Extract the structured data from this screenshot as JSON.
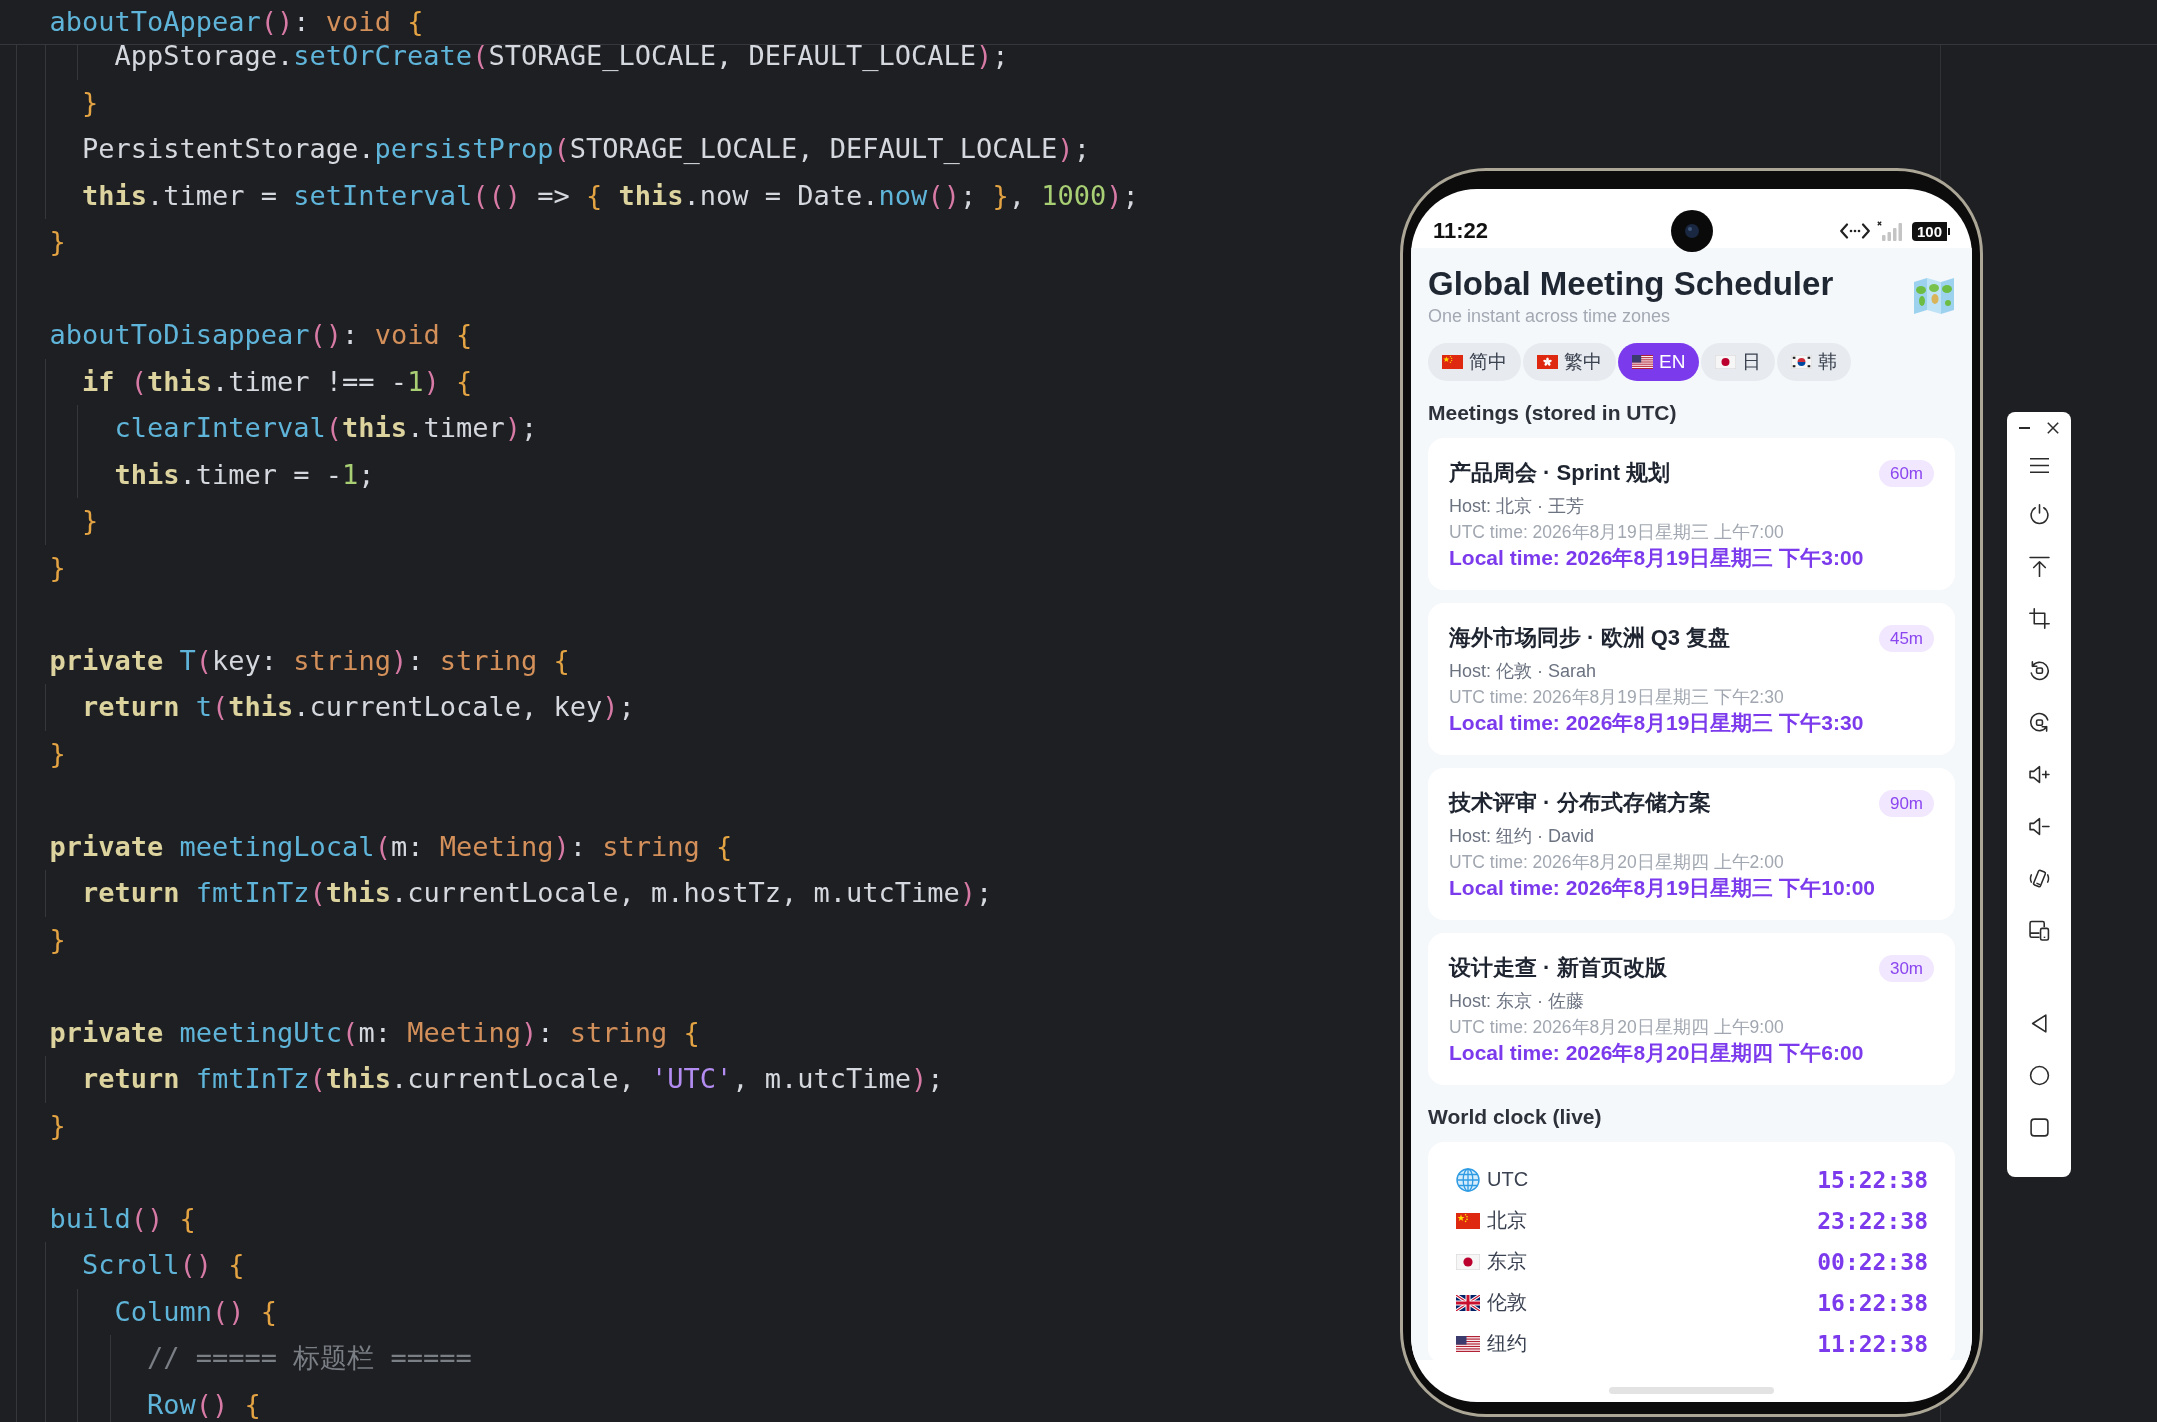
{
  "editor": {
    "sticky_line": {
      "tokens": [
        {
          "text": "  aboutToAppear",
          "kind": "function"
        },
        {
          "text": "()",
          "kind": "paren"
        },
        {
          "text": ": ",
          "kind": "plain"
        },
        {
          "text": "void",
          "kind": "type"
        },
        {
          "text": " {",
          "kind": "brace"
        }
      ]
    },
    "blocks": [
      {
        "lines": [
          {
            "tokens": [
              {
                "text": "      AppStorage.",
                "kind": "plain"
              },
              {
                "text": "setOrCreate",
                "kind": "function"
              },
              {
                "text": "(",
                "kind": "paren"
              },
              {
                "text": "STORAGE_LOCALE, DEFAULT_LOCALE",
                "kind": "plain"
              },
              {
                "text": ")",
                "kind": "paren"
              },
              {
                "text": ";",
                "kind": "plain"
              }
            ]
          },
          {
            "tokens": [
              {
                "text": "    }",
                "kind": "brace"
              }
            ]
          },
          {
            "tokens": [
              {
                "text": "    PersistentStorage.",
                "kind": "plain"
              },
              {
                "text": "persistProp",
                "kind": "function"
              },
              {
                "text": "(",
                "kind": "paren"
              },
              {
                "text": "STORAGE_LOCALE, DEFAULT_LOCALE",
                "kind": "plain"
              },
              {
                "text": ")",
                "kind": "paren"
              },
              {
                "text": ";",
                "kind": "plain"
              }
            ]
          },
          {
            "tokens": [
              {
                "text": "    this",
                "kind": "keyword"
              },
              {
                "text": ".timer = ",
                "kind": "plain"
              },
              {
                "text": "setInterval",
                "kind": "function"
              },
              {
                "text": "(()",
                "kind": "paren"
              },
              {
                "text": " => ",
                "kind": "plain"
              },
              {
                "text": "{",
                "kind": "brace"
              },
              {
                "text": " this",
                "kind": "keyword"
              },
              {
                "text": ".now = Date.",
                "kind": "plain"
              },
              {
                "text": "now",
                "kind": "function"
              },
              {
                "text": "()",
                "kind": "paren"
              },
              {
                "text": "; ",
                "kind": "plain"
              },
              {
                "text": "}",
                "kind": "brace"
              },
              {
                "text": ", ",
                "kind": "plain"
              },
              {
                "text": "1000",
                "kind": "number"
              },
              {
                "text": ")",
                "kind": "paren"
              },
              {
                "text": ";",
                "kind": "plain"
              }
            ]
          },
          {
            "tokens": [
              {
                "text": "  }",
                "kind": "brace"
              }
            ]
          }
        ]
      },
      {
        "lines": [
          {
            "tokens": [
              {
                "text": "  aboutToDisappear",
                "kind": "function"
              },
              {
                "text": "()",
                "kind": "paren"
              },
              {
                "text": ": ",
                "kind": "plain"
              },
              {
                "text": "void",
                "kind": "type"
              },
              {
                "text": " {",
                "kind": "brace"
              }
            ]
          },
          {
            "tokens": [
              {
                "text": "    if",
                "kind": "keyword"
              },
              {
                "text": " (",
                "kind": "paren"
              },
              {
                "text": "this",
                "kind": "keyword"
              },
              {
                "text": ".timer !== -",
                "kind": "plain"
              },
              {
                "text": "1",
                "kind": "number"
              },
              {
                "text": ")",
                "kind": "paren"
              },
              {
                "text": " {",
                "kind": "brace"
              }
            ]
          },
          {
            "tokens": [
              {
                "text": "      clearInterval",
                "kind": "function"
              },
              {
                "text": "(",
                "kind": "paren"
              },
              {
                "text": "this",
                "kind": "keyword"
              },
              {
                "text": ".timer",
                "kind": "plain"
              },
              {
                "text": ")",
                "kind": "paren"
              },
              {
                "text": ";",
                "kind": "plain"
              }
            ]
          },
          {
            "tokens": [
              {
                "text": "      this",
                "kind": "keyword"
              },
              {
                "text": ".timer = -",
                "kind": "plain"
              },
              {
                "text": "1",
                "kind": "number"
              },
              {
                "text": ";",
                "kind": "plain"
              }
            ]
          },
          {
            "tokens": [
              {
                "text": "    }",
                "kind": "brace"
              }
            ]
          },
          {
            "tokens": [
              {
                "text": "  }",
                "kind": "brace"
              }
            ]
          }
        ]
      },
      {
        "lines": [
          {
            "tokens": [
              {
                "text": "  private",
                "kind": "keyword"
              },
              {
                "text": " T",
                "kind": "function"
              },
              {
                "text": "(",
                "kind": "paren"
              },
              {
                "text": "key: ",
                "kind": "plain"
              },
              {
                "text": "string",
                "kind": "type"
              },
              {
                "text": ")",
                "kind": "paren"
              },
              {
                "text": ": ",
                "kind": "plain"
              },
              {
                "text": "string",
                "kind": "type"
              },
              {
                "text": " {",
                "kind": "brace"
              }
            ]
          },
          {
            "tokens": [
              {
                "text": "    return",
                "kind": "keyword"
              },
              {
                "text": " t",
                "kind": "function"
              },
              {
                "text": "(",
                "kind": "paren"
              },
              {
                "text": "this",
                "kind": "keyword"
              },
              {
                "text": ".currentLocale, key",
                "kind": "plain"
              },
              {
                "text": ")",
                "kind": "paren"
              },
              {
                "text": ";",
                "kind": "plain"
              }
            ]
          },
          {
            "tokens": [
              {
                "text": "  }",
                "kind": "brace"
              }
            ]
          }
        ]
      },
      {
        "lines": [
          {
            "tokens": [
              {
                "text": "  private",
                "kind": "keyword"
              },
              {
                "text": " meetingLocal",
                "kind": "function"
              },
              {
                "text": "(",
                "kind": "paren"
              },
              {
                "text": "m: ",
                "kind": "plain"
              },
              {
                "text": "Meeting",
                "kind": "type"
              },
              {
                "text": ")",
                "kind": "paren"
              },
              {
                "text": ": ",
                "kind": "plain"
              },
              {
                "text": "string",
                "kind": "type"
              },
              {
                "text": " {",
                "kind": "brace"
              }
            ]
          },
          {
            "tokens": [
              {
                "text": "    return",
                "kind": "keyword"
              },
              {
                "text": " fmtInTz",
                "kind": "function"
              },
              {
                "text": "(",
                "kind": "paren"
              },
              {
                "text": "this",
                "kind": "keyword"
              },
              {
                "text": ".currentLocale, m.hostTz, m.utcTime",
                "kind": "plain"
              },
              {
                "text": ")",
                "kind": "paren"
              },
              {
                "text": ";",
                "kind": "plain"
              }
            ]
          },
          {
            "tokens": [
              {
                "text": "  }",
                "kind": "brace"
              }
            ]
          }
        ]
      },
      {
        "lines": [
          {
            "tokens": [
              {
                "text": "  private",
                "kind": "keyword"
              },
              {
                "text": " meetingUtc",
                "kind": "function"
              },
              {
                "text": "(",
                "kind": "paren"
              },
              {
                "text": "m: ",
                "kind": "plain"
              },
              {
                "text": "Meeting",
                "kind": "type"
              },
              {
                "text": ")",
                "kind": "paren"
              },
              {
                "text": ": ",
                "kind": "plain"
              },
              {
                "text": "string",
                "kind": "type"
              },
              {
                "text": " {",
                "kind": "brace"
              }
            ]
          },
          {
            "tokens": [
              {
                "text": "    return",
                "kind": "keyword"
              },
              {
                "text": " fmtInTz",
                "kind": "function"
              },
              {
                "text": "(",
                "kind": "paren"
              },
              {
                "text": "this",
                "kind": "keyword"
              },
              {
                "text": ".currentLocale, ",
                "kind": "plain"
              },
              {
                "text": "'UTC'",
                "kind": "string"
              },
              {
                "text": ", m.utcTime",
                "kind": "plain"
              },
              {
                "text": ")",
                "kind": "paren"
              },
              {
                "text": ";",
                "kind": "plain"
              }
            ]
          },
          {
            "tokens": [
              {
                "text": "  }",
                "kind": "brace"
              }
            ]
          }
        ]
      },
      {
        "lines": [
          {
            "tokens": [
              {
                "text": "  build",
                "kind": "function"
              },
              {
                "text": "()",
                "kind": "paren"
              },
              {
                "text": " {",
                "kind": "brace"
              }
            ]
          },
          {
            "tokens": [
              {
                "text": "    Scroll",
                "kind": "function"
              },
              {
                "text": "()",
                "kind": "paren"
              },
              {
                "text": " {",
                "kind": "brace"
              }
            ]
          },
          {
            "tokens": [
              {
                "text": "      Column",
                "kind": "function"
              },
              {
                "text": "()",
                "kind": "paren"
              },
              {
                "text": " {",
                "kind": "brace"
              }
            ]
          },
          {
            "tokens": [
              {
                "text": "        // ===== 标题栏 =====",
                "kind": "comment"
              }
            ]
          },
          {
            "tokens": [
              {
                "text": "        Row",
                "kind": "function"
              },
              {
                "text": "()",
                "kind": "paren"
              },
              {
                "text": " {",
                "kind": "brace"
              }
            ]
          }
        ]
      }
    ]
  },
  "status_bar": {
    "time": "11:22",
    "battery": "100"
  },
  "app": {
    "title": "Global Meeting Scheduler",
    "subtitle": "One instant across time zones",
    "languages": [
      {
        "label": "简中",
        "kind": "cn",
        "selected": false
      },
      {
        "label": "繁中",
        "kind": "hk",
        "selected": false
      },
      {
        "label": "EN",
        "kind": "us",
        "selected": true
      },
      {
        "label": "日",
        "kind": "jp",
        "selected": false
      },
      {
        "label": "韩",
        "kind": "kr",
        "selected": false
      }
    ],
    "meetings_heading": "Meetings (stored in UTC)",
    "meetings": [
      {
        "title": "产品周会 · Sprint 规划",
        "duration": "60m",
        "host": "Host: 北京 · 王芳",
        "utc_time": "UTC time: 2026年8月19日星期三 上午7:00",
        "local_time": "Local time: 2026年8月19日星期三 下午3:00"
      },
      {
        "title": "海外市场同步 · 欧洲 Q3 复盘",
        "duration": "45m",
        "host": "Host: 伦敦 · Sarah",
        "utc_time": "UTC time: 2026年8月19日星期三 下午2:30",
        "local_time": "Local time: 2026年8月19日星期三 下午3:30"
      },
      {
        "title": "技术评审 · 分布式存储方案",
        "duration": "90m",
        "host": "Host: 纽约 · David",
        "utc_time": "UTC time: 2026年8月20日星期四 上午2:00",
        "local_time": "Local time: 2026年8月19日星期三 下午10:00"
      },
      {
        "title": "设计走查 · 新首页改版",
        "duration": "30m",
        "host": "Host: 东京 · 佐藤",
        "utc_time": "UTC time: 2026年8月20日星期四 上午9:00",
        "local_time": "Local time: 2026年8月20日星期四 下午6:00"
      }
    ],
    "world_clock_heading": "World clock (live)",
    "clocks": [
      {
        "kind": "globe",
        "city": "UTC",
        "time": "15:22:38"
      },
      {
        "kind": "cn",
        "city": "北京",
        "time": "23:22:38"
      },
      {
        "kind": "jp",
        "city": "东京",
        "time": "00:22:38"
      },
      {
        "kind": "gb",
        "city": "伦敦",
        "time": "16:22:38"
      },
      {
        "kind": "us",
        "city": "纽约",
        "time": "11:22:38"
      }
    ]
  }
}
